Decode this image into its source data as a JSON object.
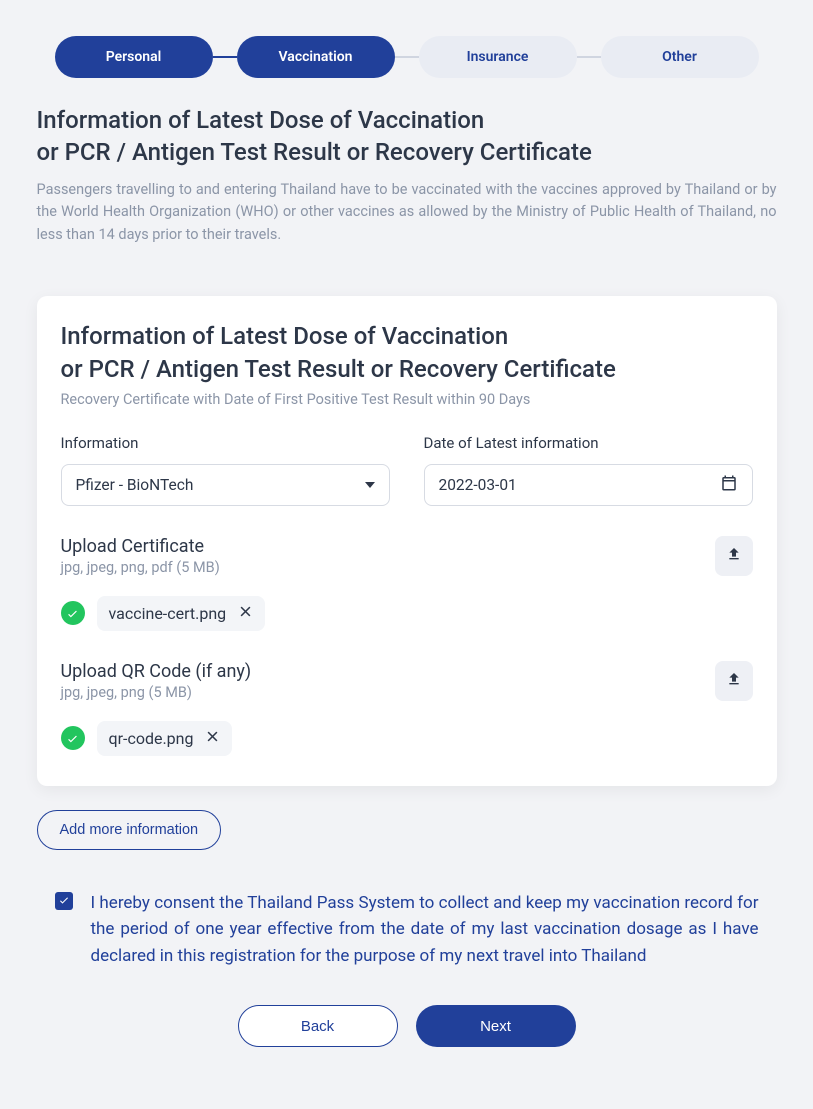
{
  "stepper": {
    "items": [
      {
        "label": "Personal"
      },
      {
        "label": "Vaccination"
      },
      {
        "label": "Insurance"
      },
      {
        "label": "Other"
      }
    ]
  },
  "header": {
    "title_line1": "Information of Latest Dose of Vaccination",
    "title_line2": "or PCR / Antigen Test Result or Recovery Certificate",
    "description": "Passengers travelling to and entering Thailand have to be vaccinated with the vaccines approved by Thailand or by the World Health Organization (WHO) or other vaccines as allowed by the Ministry of Public Health of Thailand, no less than 14 days prior to their travels."
  },
  "card": {
    "title_line1": "Information of Latest Dose of Vaccination",
    "title_line2": "or PCR / Antigen Test Result or Recovery Certificate",
    "subtitle": "Recovery Certificate with Date of First Positive Test Result within 90 Days",
    "info_label": "Information",
    "info_value": "Pfizer - BioNTech",
    "date_label": "Date of Latest information",
    "date_value": "2022-03-01",
    "upload_cert": {
      "title": "Upload Certificate",
      "hint": "jpg, jpeg, png, pdf (5 MB)",
      "file": "vaccine-cert.png"
    },
    "upload_qr": {
      "title": "Upload QR Code (if any)",
      "hint": "jpg, jpeg, png (5 MB)",
      "file": "qr-code.png"
    }
  },
  "add_more_label": "Add more information",
  "consent_text": "I hereby consent the Thailand Pass System to collect and keep my vaccination record for the period of one year effective from the date of my last vaccination dosage as I have declared in this registration for the purpose of my next travel into Thailand",
  "nav": {
    "back": "Back",
    "next": "Next"
  }
}
